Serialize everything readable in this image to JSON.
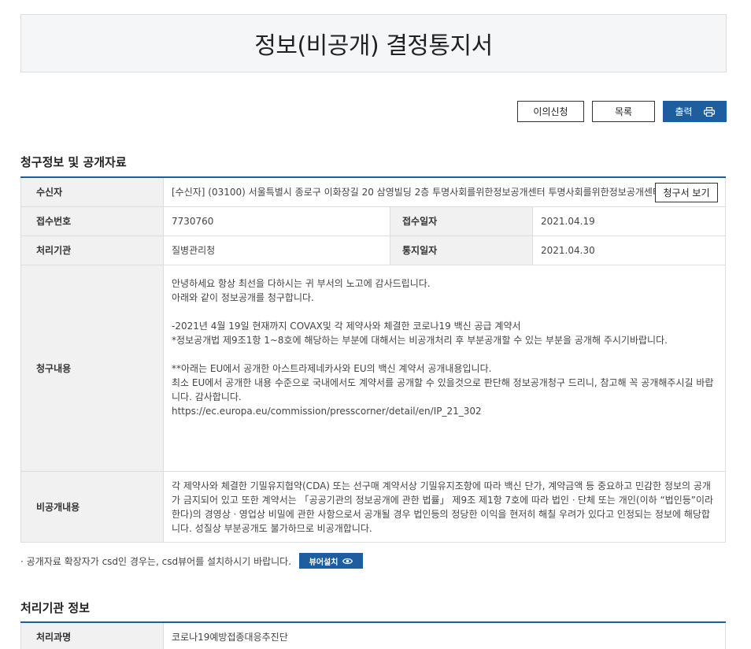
{
  "page": {
    "title": "정보(비공개) 결정통지서"
  },
  "buttons": {
    "objection": "이의신청",
    "list": "목록",
    "print": "출력"
  },
  "section1": {
    "title": "청구정보 및 공개자료",
    "recipient_label": "수신자",
    "recipient_value": "[수신자] (03100) 서울특별시 종로구 이화장길 20 삼영빌딩 2층 투명사회를위한정보공개센터 투명사회를위한정보공개센터",
    "view_request_button": "청구서 보기",
    "receipt_no_label": "접수번호",
    "receipt_no_value": "7730760",
    "receipt_date_label": "접수일자",
    "receipt_date_value": "2021.04.19",
    "agency_label": "처리기관",
    "agency_value": "질병관리청",
    "notice_date_label": "통지일자",
    "notice_date_value": "2021.04.30",
    "request_content_label": "청구내용",
    "request_content_lines": [
      "안녕하세요 항상 최선을 다하시는 귀 부서의 노고에 감사드립니다.",
      "아래와 같이 정보공개를 청구합니다.",
      "",
      "-2021년 4월 19일 현재까지 COVAX및 각 제약사와 체결한 코로나19 백신 공급 계약서",
      "*정보공개법 제9조1항 1~8호에 해당하는 부분에 대해서는 비공개처리 후 부분공개할 수 있는 부분을 공개해 주시기바랍니다.",
      "",
      "**아래는 EU에서 공개한 아스트라제네카사와 EU의 백신 계약서 공개내용입니다.",
      "최소 EU에서 공개한 내용 수준으로 국내에서도 계약서를 공개할 수 있을것으로 판단해 정보공개청구 드리니, 참고해 꼭 공개해주시길 바랍니다. 감사합니다.",
      "https://ec.europa.eu/commission/presscorner/detail/en/IP_21_302"
    ],
    "nondisclosure_label": "비공개내용",
    "nondisclosure_text": "각 제약사와 체결한 기밀유지협약(CDA) 또는 선구매 계약서상 기밀유지조항에 따라 백신 단가, 계약금액 등 중요하고 민감한 정보의 공개가 금지되어 있고 또한 계약서는 「공공기관의 정보공개에 관한 법률」 제9조 제1항 7호에 따라 법인ㆍ단체 또는 개인(이하 “법인등”이라 한다)의 경영상ㆍ영업상 비밀에 관한 사항으로서 공개될 경우 법인등의 정당한 이익을 현저히 해칠 우려가 있다고 인정되는 정보에 해당합니다. 성질상 부분공개도 불가하므로 비공개합니다."
  },
  "note": {
    "text": "· 공개자료 확장자가 csd인 경우는, csd뷰어를 설치하시기 바랍니다.",
    "viewer_button": "뷰어설치"
  },
  "section2": {
    "title": "처리기관 정보",
    "dept_label": "처리과명",
    "dept_value": "코로나19예방접종대응추진단"
  },
  "colors": {
    "accent": "#1e5e9e",
    "header_bg": "#f1f1f1",
    "title_bg": "#f5f6f7"
  },
  "icons": {
    "print": "printer-icon",
    "viewer": "eye-icon"
  }
}
